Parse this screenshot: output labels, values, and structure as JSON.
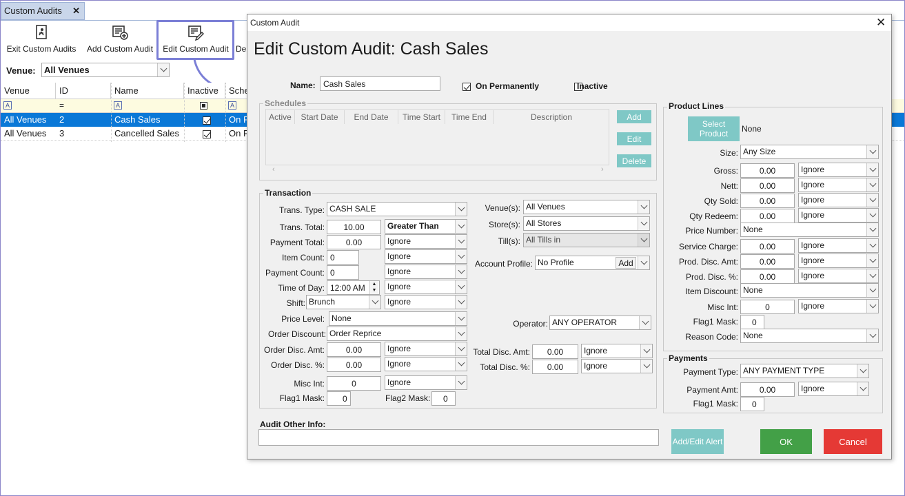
{
  "app": {
    "tab_label": "Custom Audits",
    "toolbar": {
      "exit": "Exit Custom Audits",
      "add": "Add Custom Audit",
      "edit": "Edit Custom Audit",
      "delete_partial": "De"
    },
    "venue_label": "Venue:",
    "venue_value": "All Venues",
    "grid": {
      "columns": [
        "Venue",
        "ID",
        "Name",
        "Inactive",
        "Sche"
      ],
      "filter_id": "=",
      "rows": [
        {
          "venue": "All Venues",
          "id": "2",
          "name": "Cash Sales",
          "inactive": true,
          "sched": "On P"
        },
        {
          "venue": "All Venues",
          "id": "3",
          "name": "Cancelled Sales",
          "inactive": true,
          "sched": "On P"
        }
      ]
    }
  },
  "dialog": {
    "window_title": "Custom Audit",
    "heading": "Edit Custom Audit: Cash Sales",
    "name_label": "Name:",
    "name_value": "Cash Sales",
    "on_permanently_label": "On Permanently",
    "inactive_label": "Inactive",
    "schedules": {
      "title": "Schedules",
      "columns": [
        "Active",
        "Start Date",
        "End Date",
        "Time Start",
        "Time End",
        "Description"
      ],
      "add": "Add",
      "edit": "Edit",
      "delete": "Delete"
    },
    "transaction": {
      "title": "Transaction",
      "trans_type_label": "Trans. Type:",
      "trans_type": "CASH SALE",
      "trans_total_label": "Trans. Total:",
      "trans_total": "10.00",
      "trans_total_op": "Greater Than",
      "payment_total_label": "Payment Total:",
      "payment_total": "0.00",
      "payment_total_op": "Ignore",
      "item_count_label": "Item Count:",
      "item_count": "0",
      "item_count_op": "Ignore",
      "payment_count_label": "Payment Count:",
      "payment_count": "0",
      "payment_count_op": "Ignore",
      "time_of_day_label": "Time of Day:",
      "time_of_day": "12:00 AM",
      "time_of_day_op": "Ignore",
      "shift_label": "Shift:",
      "shift": "Brunch",
      "shift_op": "Ignore",
      "price_level_label": "Price Level:",
      "price_level": "None",
      "order_discount_label": "Order Discount:",
      "order_discount": "Order Reprice",
      "order_disc_amt_label": "Order Disc. Amt:",
      "order_disc_amt": "0.00",
      "order_disc_amt_op": "Ignore",
      "order_disc_pct_label": "Order Disc. %:",
      "order_disc_pct": "0.00",
      "order_disc_pct_op": "Ignore",
      "misc_int_label": "Misc Int:",
      "misc_int": "0",
      "misc_int_op": "Ignore",
      "flag1_label": "Flag1 Mask:",
      "flag1": "0",
      "flag2_label": "Flag2 Mask:",
      "flag2": "0",
      "venues_label": "Venue(s):",
      "venues": "All Venues",
      "stores_label": "Store(s):",
      "stores": "All Stores",
      "tills_label": "Till(s):",
      "tills": "All Tills in",
      "account_profile_label": "Account Profile:",
      "account_profile": "No Profile",
      "account_add": "Add",
      "operator_label": "Operator:",
      "operator": "ANY OPERATOR",
      "total_disc_amt_label": "Total Disc. Amt:",
      "total_disc_amt": "0.00",
      "total_disc_amt_op": "Ignore",
      "total_disc_pct_label": "Total Disc. %:",
      "total_disc_pct": "0.00",
      "total_disc_pct_op": "Ignore"
    },
    "product_lines": {
      "title": "Product Lines",
      "select_product": "Select Product",
      "product_value": "None",
      "size_label": "Size:",
      "size": "Any Size",
      "gross_label": "Gross:",
      "gross": "0.00",
      "gross_op": "Ignore",
      "nett_label": "Nett:",
      "nett": "0.00",
      "nett_op": "Ignore",
      "qty_sold_label": "Qty Sold:",
      "qty_sold": "0.00",
      "qty_sold_op": "Ignore",
      "qty_redeem_label": "Qty Redeem:",
      "qty_redeem": "0.00",
      "qty_redeem_op": "Ignore",
      "price_number_label": "Price Number:",
      "price_number": "None",
      "service_charge_label": "Service Charge:",
      "service_charge": "0.00",
      "service_charge_op": "Ignore",
      "prod_disc_amt_label": "Prod. Disc. Amt:",
      "prod_disc_amt": "0.00",
      "prod_disc_amt_op": "Ignore",
      "prod_disc_pct_label": "Prod. Disc. %:",
      "prod_disc_pct": "0.00",
      "prod_disc_pct_op": "Ignore",
      "item_discount_label": "Item Discount:",
      "item_discount": "None",
      "misc_int_label": "Misc Int:",
      "misc_int": "0",
      "misc_int_op": "Ignore",
      "flag1_label": "Flag1 Mask:",
      "flag1": "0",
      "reason_code_label": "Reason Code:",
      "reason_code": "None"
    },
    "payments": {
      "title": "Payments",
      "payment_type_label": "Payment Type:",
      "payment_type": "ANY PAYMENT TYPE",
      "payment_amt_label": "Payment Amt:",
      "payment_amt": "0.00",
      "payment_amt_op": "Ignore",
      "flag1_label": "Flag1 Mask:",
      "flag1": "0"
    },
    "audit_other_info_label": "Audit Other Info:",
    "add_edit_alert": "Add/Edit Alert",
    "ok": "OK",
    "cancel": "Cancel"
  },
  "colors": {
    "teal": "#7fc8c6",
    "ok": "#43a047",
    "cancel": "#e53935",
    "selection": "#0a78d7",
    "highlight": "#7b7fd6"
  }
}
